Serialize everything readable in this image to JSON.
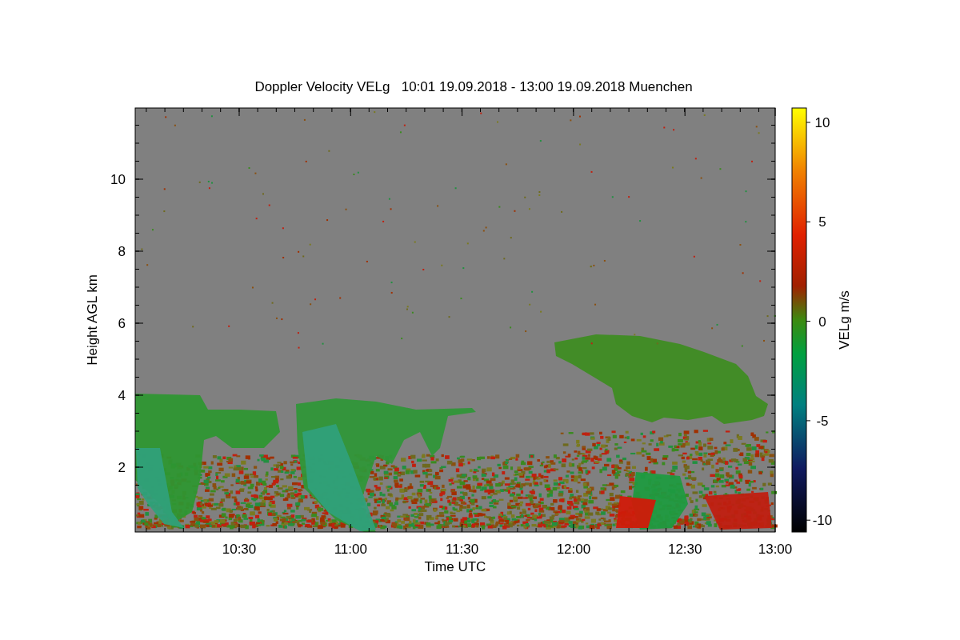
{
  "title": "Doppler Velocity VELg   10:01 19.09.2018 - 13:00 19.09.2018 Muenchen",
  "plot": {
    "xlabel": "Time UTC",
    "ylabel": "Height AGL km",
    "xticks": [
      "10:30",
      "11:00",
      "11:30",
      "12:00",
      "12:30",
      "13:00"
    ],
    "yticks": [
      "10",
      "8",
      "6",
      "4",
      "2"
    ]
  },
  "colorbar": {
    "label": "VELg m/s",
    "ticks": [
      "10",
      "5",
      "0",
      "-5",
      "-10"
    ]
  }
}
